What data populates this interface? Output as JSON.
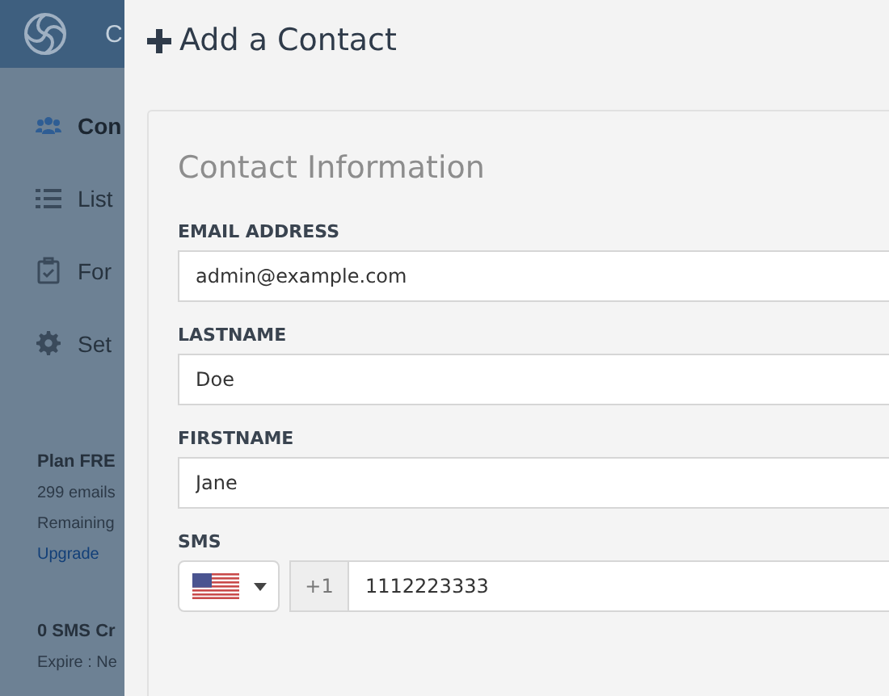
{
  "app": {
    "name": "C"
  },
  "sidebar": {
    "items": [
      {
        "label": "Con",
        "selected": true
      },
      {
        "label": "List",
        "selected": false
      },
      {
        "label": "For",
        "selected": false
      },
      {
        "label": "Set",
        "selected": false
      }
    ],
    "plan": {
      "title": "Plan FRE",
      "emails": "299 emails",
      "remaining": "Remaining",
      "upgrade": "Upgrade"
    },
    "sms": {
      "title": "0 SMS Cr",
      "expire": "Expire : Ne"
    }
  },
  "panel": {
    "title": "Add a Contact",
    "section": "Contact Information",
    "fields": [
      {
        "label": "EMAIL ADDRESS",
        "value": "admin@example.com"
      },
      {
        "label": "LASTNAME",
        "value": "Doe"
      },
      {
        "label": "FIRSTNAME",
        "value": "Jane"
      }
    ],
    "sms": {
      "label": "SMS",
      "prefix": "+1",
      "value": "1112223333"
    }
  }
}
